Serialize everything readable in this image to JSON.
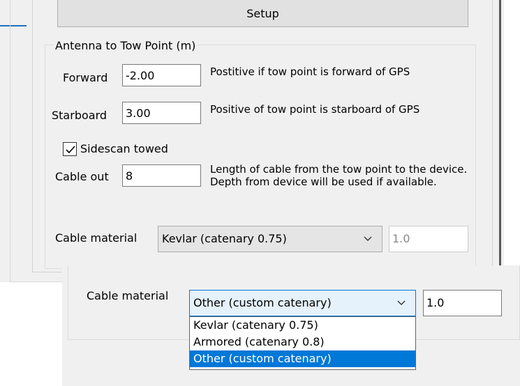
{
  "setup_button": {
    "label": "Setup"
  },
  "antenna_group": {
    "title": "Antenna to Tow Point (m)",
    "forward": {
      "label": "Forward",
      "value": "-2.00",
      "help": "Postitive if tow point is forward of GPS"
    },
    "starboard": {
      "label": "Starboard",
      "value": "3.00",
      "help": "Positive of tow point is starboard of GPS"
    },
    "sidescan_towed": {
      "label": "Sidescan towed",
      "checked": true
    },
    "cable_out": {
      "label": "Cable out",
      "value": "8",
      "help": "Length of cable from the tow point to the device. Depth from device will be used if available."
    },
    "cable_material": {
      "label": "Cable material",
      "selected": "Kevlar (catenary 0.75)",
      "catenary_value": "1.0"
    }
  },
  "popup": {
    "cable_material": {
      "label": "Cable material",
      "selected": "Other (custom catenary)",
      "catenary_value": "1.0",
      "options": [
        "Kevlar (catenary 0.75)",
        "Armored (catenary 0.8)",
        "Other (custom catenary)"
      ],
      "highlighted_index": 2
    }
  },
  "colors": {
    "accent": "#0078d7",
    "window_bg": "#f0f0f0",
    "combo_focus_border": "#0078d7"
  },
  "icons": {
    "dropdown": "chevron-down-icon",
    "check": "checkmark-icon"
  }
}
